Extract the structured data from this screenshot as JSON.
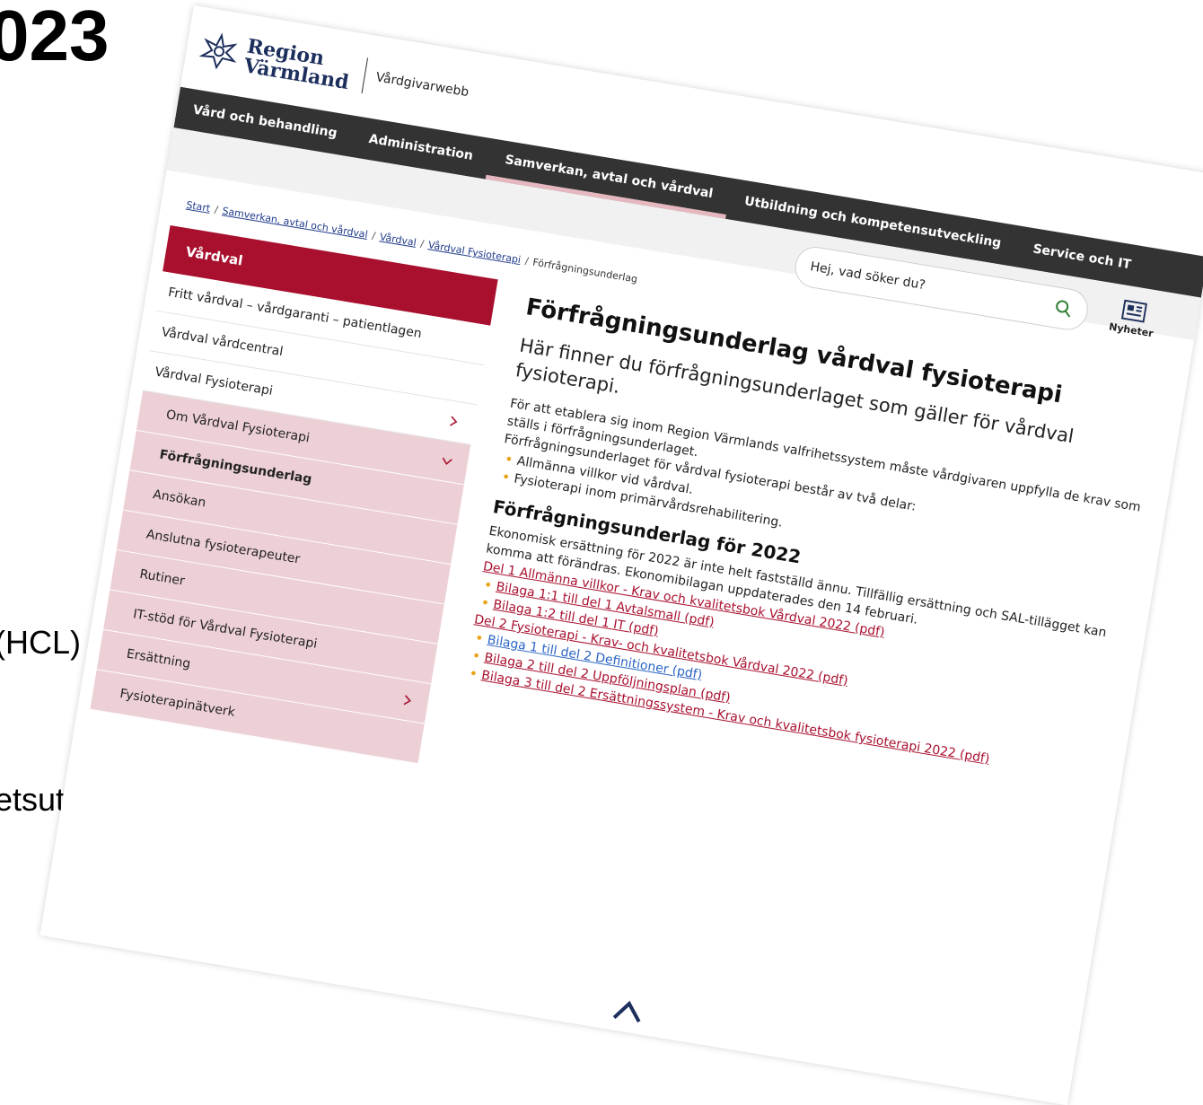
{
  "slide": {
    "year_fragment": "023",
    "hcl_fragment": "(HCL)",
    "hsn_fragment": "etsutskott HSN AU"
  },
  "logo": {
    "line1": "Region",
    "line2": "Värmland",
    "site_name": "Vårdgivarwebb"
  },
  "topnav": {
    "items": [
      {
        "label": "Vård och behandling",
        "active": false
      },
      {
        "label": "Administration",
        "active": false
      },
      {
        "label": "Samverkan, avtal och vårdval",
        "active": true
      },
      {
        "label": "Utbildning och kompetensutveckling",
        "active": false
      },
      {
        "label": "Service och IT",
        "active": false
      }
    ]
  },
  "search": {
    "placeholder": "Hej, vad söker du?",
    "icon": "search-icon"
  },
  "news": {
    "label": "Nyheter",
    "icon": "newspaper-icon"
  },
  "breadcrumb": {
    "links": [
      "Start",
      "Samverkan, avtal och vårdval",
      "Vårdval",
      "Vårdval Fysioterapi"
    ],
    "current": "Förfrågningsunderlag",
    "separator": "/"
  },
  "sidenav": {
    "header": "Vårdval",
    "items": [
      {
        "label": "Fritt vårdval – vårdgaranti – patientlagen"
      },
      {
        "label": "Vårdval vårdcentral"
      },
      {
        "label": "Vårdval Fysioterapi"
      },
      {
        "label": "Om Vårdval Fysioterapi"
      },
      {
        "label": "Förfrågningsunderlag"
      },
      {
        "label": "Ansökan"
      },
      {
        "label": "Anslutna fysioterapeuter"
      },
      {
        "label": "Rutiner"
      },
      {
        "label": "IT-stöd för Vårdval Fysioterapi"
      },
      {
        "label": "Ersättning"
      },
      {
        "label": "Fysioterapinätverk"
      }
    ]
  },
  "main": {
    "title": "Förfrågningsunderlag vårdval fysioterapi",
    "lead": "Här finner du förfrågningsunderlaget som gäller för vårdval fysioterapi.",
    "intro": "För att etablera sig inom Region Värmlands valfrihetssystem måste vårdgivaren uppfylla de krav som ställs i förfrågningsunderlaget.",
    "parts_intro": "Förfrågningsunderlaget för vårdval fysioterapi består av två delar:",
    "parts": [
      "Allmänna villkor vid vårdval.",
      "Fysioterapi inom primärvårdsrehabilitering."
    ],
    "section_title": "Förfrågningsunderlag för 2022",
    "section_text": "Ekonomisk ersättning för 2022 är inte helt fastställd ännu. Tillfällig ersättning och SAL-tillägget kan komma att förändras. Ekonomibilagan uppdaterades den 14 februari.",
    "part1_link": "Del 1 Allmänna villkor - Krav och kvalitetsbok Vårdval 2022 (pdf)",
    "part1_attachments": [
      "Bilaga 1:1 till del 1 Avtalsmall (pdf)",
      "Bilaga 1:2 till del 1 IT (pdf)"
    ],
    "part2_link": "Del 2 Fysioterapi - Krav- och kvalitetsbok Vårdval 2022 (pdf)",
    "part2_attachments": [
      "Bilaga 1 till del 2 Definitioner (pdf)",
      "Bilaga 2 till del 2 Uppföljningsplan (pdf)",
      "Bilaga 3 till del 2 Ersättningssystem - Krav och kvalitetsbok fysioterapi 2022 (pdf)"
    ]
  },
  "colors": {
    "brand_red": "#a8102e",
    "nav_dark": "#333333",
    "submenu_pink": "#ecd0d6",
    "bullet": "#e8a317",
    "active_underline": "#e5b8c0",
    "visited_link": "#2a64c4"
  }
}
